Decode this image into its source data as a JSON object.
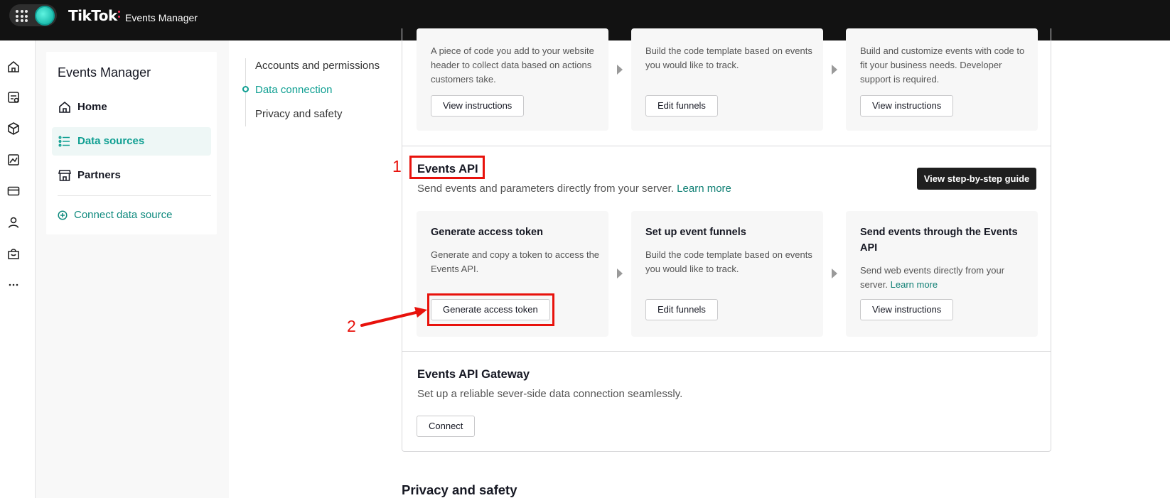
{
  "topbar": {
    "brand": "TikTok",
    "product": "Events Manager",
    "brand_accent": "#fe2c55",
    "orb_color": "#2fd6c6"
  },
  "rail": {
    "icons": [
      "home-icon",
      "campaign-icon",
      "catalog-icon",
      "analytics-icon",
      "payment-icon",
      "user-icon",
      "shop-icon",
      "more-icon"
    ]
  },
  "sidebar": {
    "title": "Events Manager",
    "items": [
      {
        "label": "Home",
        "icon": "home-icon",
        "active": false
      },
      {
        "label": "Data sources",
        "icon": "list-icon",
        "active": true
      },
      {
        "label": "Partners",
        "icon": "store-icon",
        "active": false
      }
    ],
    "connect": "Connect data source"
  },
  "subnav": {
    "items": [
      {
        "label": "Accounts and permissions",
        "active": false
      },
      {
        "label": "Data connection",
        "active": true
      },
      {
        "label": "Privacy and safety",
        "active": false
      }
    ]
  },
  "pixel_section": {
    "cards": [
      {
        "desc": "A piece of code you add to your website header to collect data based on actions customers take.",
        "button": "View instructions"
      },
      {
        "desc": "Build the code template based on events you would like to track.",
        "button": "Edit funnels"
      },
      {
        "desc": "Build and customize events with code to fit your business needs. Developer support is required.",
        "button": "View instructions"
      }
    ]
  },
  "events_api": {
    "title": "Events API",
    "subtitle": "Send events and parameters directly from your server.",
    "learn_more": "Learn more",
    "guide_button": "View step-by-step guide",
    "cards": [
      {
        "title": "Generate access token",
        "desc": "Generate and copy a token to access the Events API.",
        "button": "Generate access token"
      },
      {
        "title": "Set up event funnels",
        "desc": "Build the code template based on events you would like to track.",
        "button": "Edit funnels"
      },
      {
        "title": "Send events through the Events API",
        "desc": "Send web events directly from your server.",
        "desc_link": "Learn more",
        "button": "View instructions"
      }
    ]
  },
  "gateway": {
    "title": "Events API Gateway",
    "subtitle": "Set up a reliable sever-side data connection seamlessly.",
    "button": "Connect"
  },
  "privacy": {
    "title": "Privacy and safety"
  },
  "annotations": {
    "step1": "1",
    "step2": "2",
    "color": "#e8120c"
  },
  "colors": {
    "accent": "#0f9f92",
    "link": "#0f7f74",
    "topbar": "#121212"
  }
}
